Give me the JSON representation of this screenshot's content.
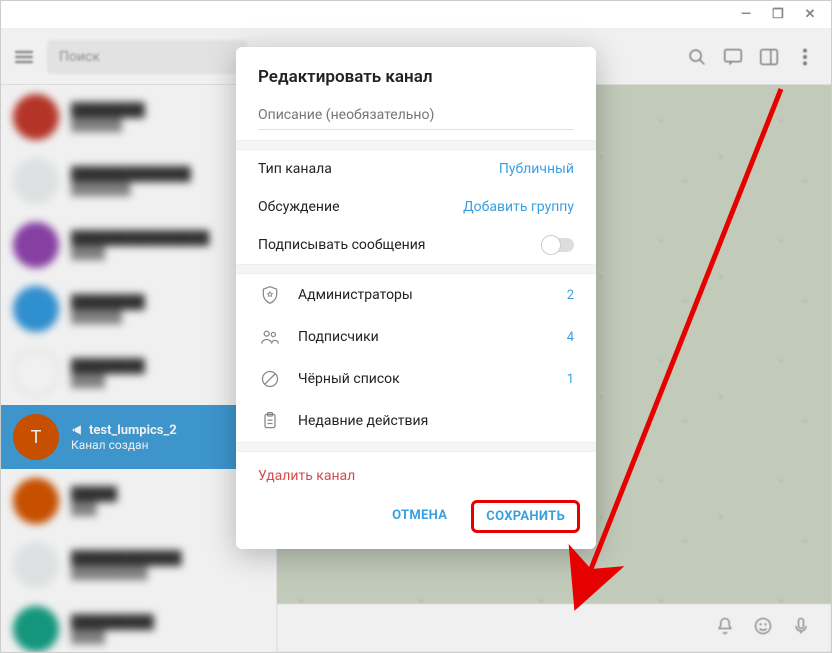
{
  "window": {
    "minimize": "—",
    "restore": "❐",
    "close": "✕"
  },
  "topbar": {
    "search_placeholder": "Поиск"
  },
  "active_chat": {
    "letter": "T",
    "title": "test_lumpics_2",
    "subtitle": "Канал создан"
  },
  "modal": {
    "title": "Редактировать канал",
    "description_placeholder": "Описание (необязательно)",
    "type_label": "Тип канала",
    "type_value": "Публичный",
    "discussion_label": "Обсуждение",
    "discussion_value": "Добавить группу",
    "sign_label": "Подписывать сообщения",
    "admins_label": "Администраторы",
    "admins_count": "2",
    "subs_label": "Подписчики",
    "subs_count": "4",
    "blacklist_label": "Чёрный список",
    "blacklist_count": "1",
    "recent_label": "Недавние действия",
    "delete": "Удалить канал",
    "cancel": "ОТМЕНА",
    "save": "СОХРАНИТЬ"
  }
}
